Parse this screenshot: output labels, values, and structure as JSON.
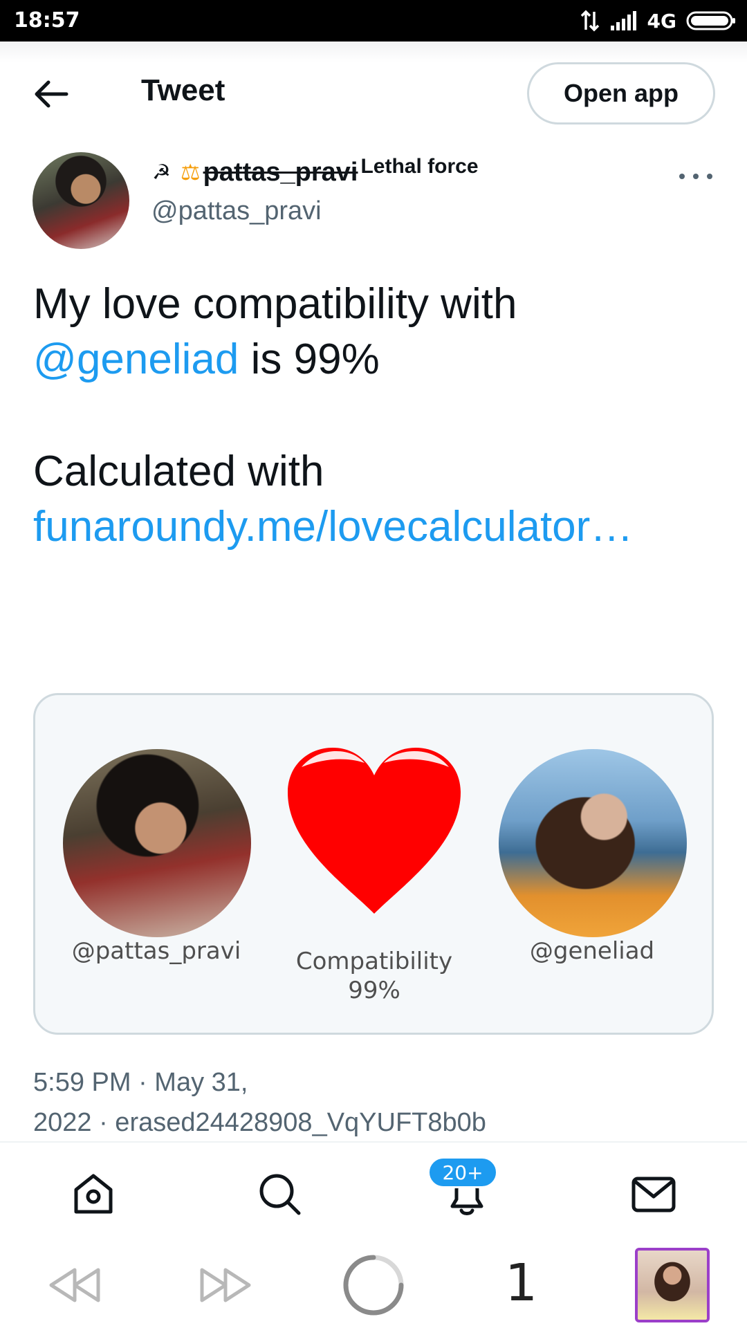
{
  "status_bar": {
    "time": "18:57",
    "network": "4G"
  },
  "header": {
    "title": "Tweet",
    "open_app_label": "Open app"
  },
  "author": {
    "display_name": "pattas_pravi",
    "name_suffix": "Lethal force",
    "handle": "@pattas_pravi"
  },
  "tweet": {
    "line1": "My love compatibility with",
    "mention": "@geneliad",
    "line2_rest": " is 99%",
    "line3": "Calculated with",
    "link": "funaroundy.me/lovecalculator…"
  },
  "card": {
    "left_handle": "@pattas_pravi",
    "right_handle": "@geneliad",
    "compatibility_label": "Compatibility",
    "compatibility_value": "99%"
  },
  "timestamp": {
    "line1": "5:59 PM · May 31,",
    "line2": "2022 · erased24428908_VqYUFT8b0b"
  },
  "bottom_nav": {
    "notifications_badge": "20+"
  },
  "browser": {
    "tab_count": "1"
  },
  "colors": {
    "accent": "#1d9bf0",
    "text": "#0f1419",
    "secondary": "#536471",
    "heart": "#ff0000"
  },
  "icons": {
    "header": "back-arrow-icon",
    "nav": [
      "home-icon",
      "search-icon",
      "notifications-icon",
      "messages-icon"
    ],
    "browser": [
      "back-icon",
      "forward-icon",
      "loading-icon",
      "tab-thumbnail"
    ]
  }
}
